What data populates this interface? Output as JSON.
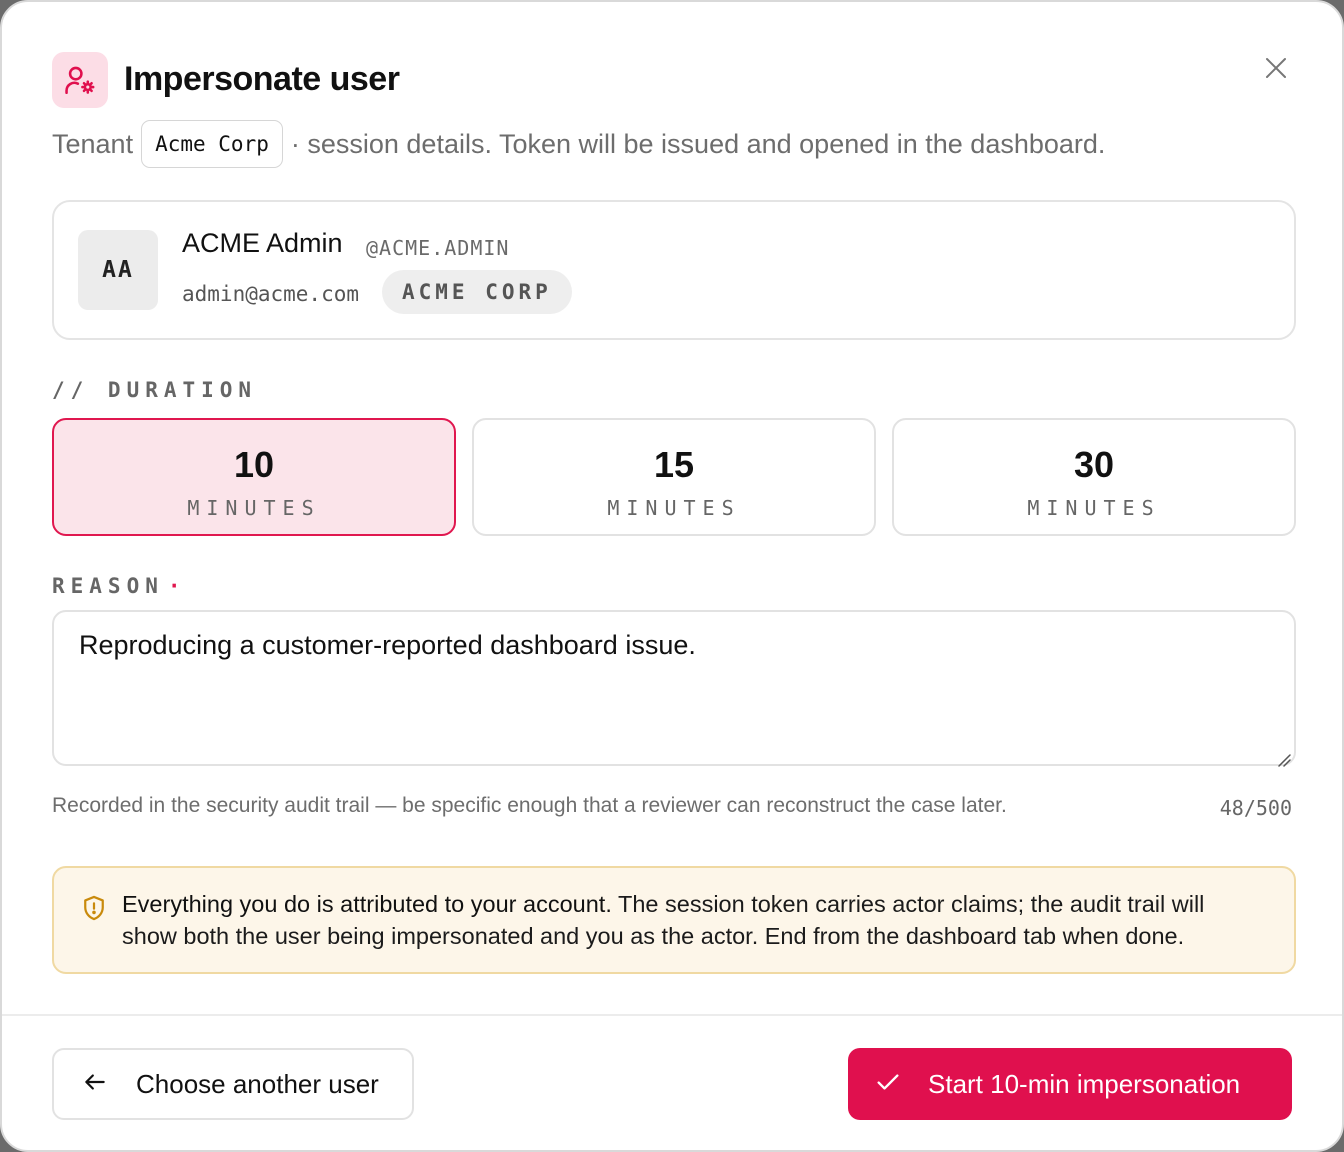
{
  "header": {
    "icon": "user-gear-icon",
    "title": "Impersonate user",
    "close_icon": "close-icon"
  },
  "subtitle": {
    "prefix": "Tenant",
    "tenant": "Acme Corp",
    "suffix": "· session details. Token will be issued and opened in the dashboard."
  },
  "user": {
    "initials": "AA",
    "name": "ACME Admin",
    "handle": "@ACME.ADMIN",
    "email": "admin@acme.com",
    "org": "ACME CORP"
  },
  "duration": {
    "label": "// DURATION",
    "selected": "10",
    "options": [
      {
        "value": "10",
        "unit": "MINUTES"
      },
      {
        "value": "15",
        "unit": "MINUTES"
      },
      {
        "value": "30",
        "unit": "MINUTES"
      }
    ]
  },
  "reason": {
    "label": "REASON",
    "required_marker": "·",
    "value": "Reproducing a customer-reported dashboard issue.",
    "helper": "Recorded in the security audit trail — be specific enough that a reviewer can reconstruct the case later.",
    "count": "48/500"
  },
  "warning": {
    "icon": "shield-alert-icon",
    "strong": "Everything you do is attributed to your account.",
    "body": " The session token carries actor claims; the audit trail will show both the user being impersonated and you as the actor. End from the dashboard tab when done."
  },
  "footer": {
    "back_label": "Choose another user",
    "back_icon": "arrow-left-icon",
    "start_label": "Start 10-min impersonation",
    "start_icon": "check-icon"
  },
  "colors": {
    "accent": "#e0104e",
    "accent_soft": "#fbe4ea",
    "warning_bg": "#fdf6e9",
    "warning_border": "#f0d9a2"
  }
}
